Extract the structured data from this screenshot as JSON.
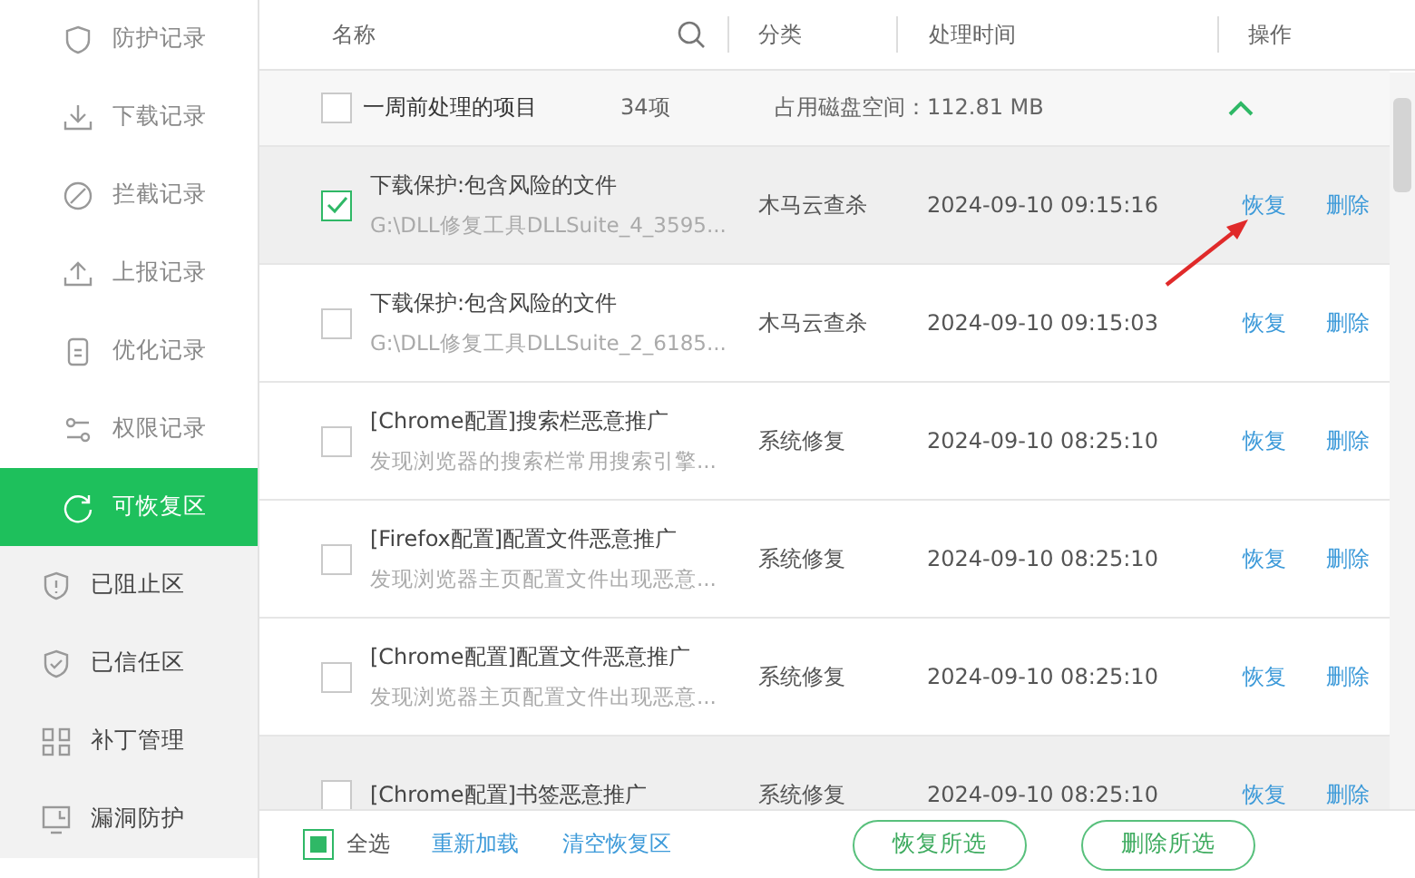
{
  "sidebar": {
    "items": [
      {
        "label": "防护记录",
        "selected": false
      },
      {
        "label": "下载记录",
        "selected": false
      },
      {
        "label": "拦截记录",
        "selected": false
      },
      {
        "label": "上报记录",
        "selected": false
      },
      {
        "label": "优化记录",
        "selected": false
      },
      {
        "label": "权限记录",
        "selected": false
      },
      {
        "label": "可恢复区",
        "selected": true
      },
      {
        "label": "已阻止区",
        "selected": false
      },
      {
        "label": "已信任区",
        "selected": false
      },
      {
        "label": "补丁管理",
        "selected": false
      },
      {
        "label": "漏洞防护",
        "selected": false
      }
    ]
  },
  "table": {
    "columns": [
      "名称",
      "分类",
      "处理时间",
      "操作"
    ],
    "group": {
      "checked": false,
      "title": "一周前处理的项目",
      "count": "34项",
      "disk": "占用磁盘空间：112.81 MB",
      "expanded": true
    },
    "rows": [
      {
        "title": "下载保护:包含风险的文件",
        "detail": "G:\\DLL修复工具DLLSuite_4_3595...",
        "category": "木马云查杀",
        "time": "2024-09-10 09:15:16",
        "checked": true,
        "selected": true,
        "actions": [
          "恢复",
          "删除"
        ]
      },
      {
        "title": "下载保护:包含风险的文件",
        "detail": "G:\\DLL修复工具DLLSuite_2_6185...",
        "category": "木马云查杀",
        "time": "2024-09-10 09:15:03",
        "checked": false,
        "selected": false,
        "actions": [
          "恢复",
          "删除"
        ]
      },
      {
        "title": "[Chrome配置]搜索栏恶意推广",
        "detail": "发现浏览器的搜索栏常用搜索引擎...",
        "category": "系统修复",
        "time": "2024-09-10 08:25:10",
        "checked": false,
        "selected": false,
        "actions": [
          "恢复",
          "删除"
        ]
      },
      {
        "title": "[Firefox配置]配置文件恶意推广",
        "detail": "发现浏览器主页配置文件出现恶意...",
        "category": "系统修复",
        "time": "2024-09-10 08:25:10",
        "checked": false,
        "selected": false,
        "actions": [
          "恢复",
          "删除"
        ]
      },
      {
        "title": "[Chrome配置]配置文件恶意推广",
        "detail": "发现浏览器主页配置文件出现恶意...",
        "category": "系统修复",
        "time": "2024-09-10 08:25:10",
        "checked": false,
        "selected": false,
        "actions": [
          "恢复",
          "删除"
        ]
      },
      {
        "title": "[Chrome配置]书签恶意推广",
        "category": "系统修复",
        "time": "2024-09-10 08:25:10",
        "checked": false,
        "selected": true,
        "actions": [
          "恢复",
          "删除"
        ]
      }
    ]
  },
  "footer": {
    "select_all": {
      "label": "全选",
      "indeterminate": true
    },
    "links": [
      "重新加载",
      "清空恢复区"
    ],
    "buttons": [
      "恢复所选",
      "删除所选"
    ]
  }
}
